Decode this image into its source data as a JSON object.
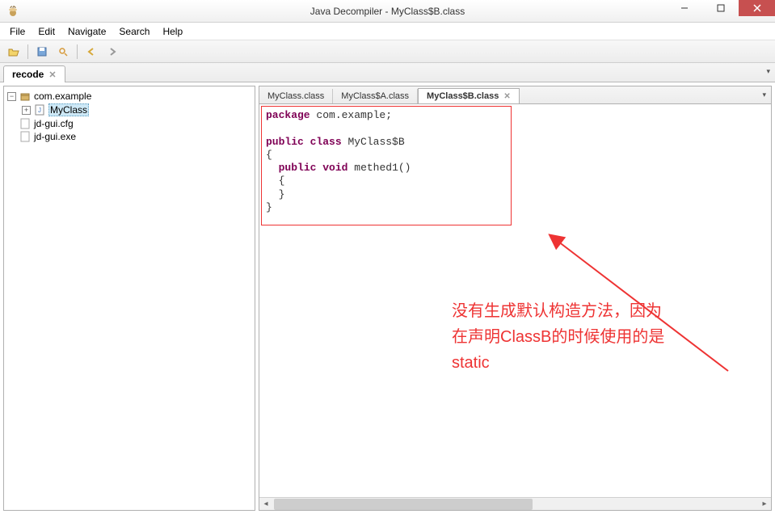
{
  "window": {
    "title": "Java Decompiler - MyClass$B.class"
  },
  "menu": {
    "file": "File",
    "edit": "Edit",
    "navigate": "Navigate",
    "search": "Search",
    "help": "Help"
  },
  "project_tab": {
    "label": "recode"
  },
  "tree": {
    "package": "com.example",
    "class": "MyClass",
    "file1": "jd-gui.cfg",
    "file2": "jd-gui.exe"
  },
  "editor_tabs": [
    {
      "label": "MyClass.class"
    },
    {
      "label": "MyClass$A.class"
    },
    {
      "label": "MyClass$B.class"
    }
  ],
  "code": {
    "kw_package": "package",
    "package_name": "com.example",
    "kw_public": "public",
    "kw_class": "class",
    "class_name": "MyClass$B",
    "kw_void": "void",
    "method_name": "methed1"
  },
  "annotation": {
    "line1": "没有生成默认构造方法，因为",
    "line2": "在声明ClassB的时候使用的是",
    "line3": "static"
  }
}
